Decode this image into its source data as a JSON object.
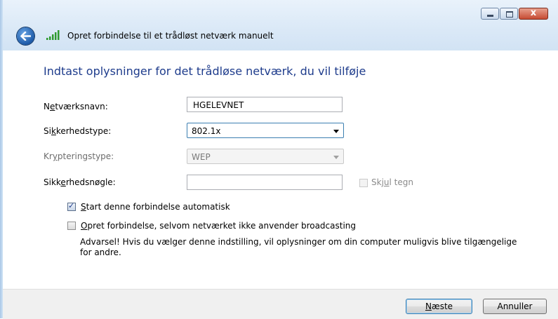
{
  "window": {
    "title": "Opret forbindelse til et trådløst netværk manuelt",
    "buttons": {
      "minimize": "minimize",
      "maximize": "maximize",
      "close": "x"
    }
  },
  "heading": "Indtast oplysninger for det trådløse netværk, du vil tilføje",
  "form": {
    "network_name": {
      "label_pre": "N",
      "label_mn": "e",
      "label_post": "tværksnavn:",
      "value": "HGELEVNET"
    },
    "security_type": {
      "label_pre": "Si",
      "label_mn": "k",
      "label_post": "kerhedstype:",
      "value": "802.1x"
    },
    "encryption_type": {
      "label_pre": "Kr",
      "label_mn": "y",
      "label_post": "pteringstype:",
      "value": "WEP"
    },
    "security_key": {
      "label_pre": "Sikk",
      "label_mn": "e",
      "label_post": "rhedsnøgle:",
      "value": ""
    },
    "hide_chars": {
      "label_pre": "Skj",
      "label_mn": "u",
      "label_post": "l tegn",
      "checked": false
    }
  },
  "options": {
    "auto_start": {
      "label_mn": "S",
      "label_post": "tart denne forbindelse automatisk",
      "checked": true
    },
    "connect_hidden": {
      "label_mn": "O",
      "label_post": "pret forbindelse, selvom netværket ikke anvender broadcasting",
      "checked": false
    },
    "warning": "Advarsel! Hvis du vælger denne indstilling, vil oplysninger om din computer muligvis blive tilgængelige for andre."
  },
  "footer": {
    "next": {
      "label_mn": "N",
      "label_post": "æste"
    },
    "cancel": "Annuller"
  },
  "colors": {
    "heading": "#1e3c8c",
    "footer": "#f0f0f0",
    "titlebar": "#dbe9f7"
  },
  "icons": {
    "back": "back-arrow-icon",
    "signal": "wireless-signal-icon"
  }
}
